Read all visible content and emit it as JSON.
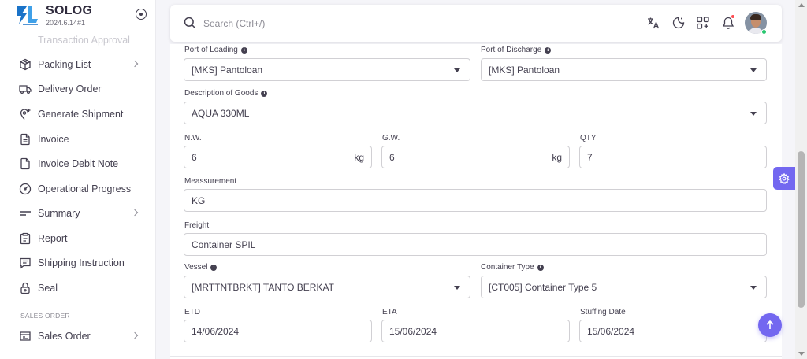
{
  "brand": {
    "name": "SOLOG",
    "version": "2024.6.14#1"
  },
  "sidebar": {
    "faded_item": "Transaction Approval",
    "items": [
      {
        "label": "Packing List",
        "icon": "package-icon",
        "has_children": true
      },
      {
        "label": "Delivery Order",
        "icon": "truck-icon",
        "has_children": false
      },
      {
        "label": "Generate Shipment",
        "icon": "map-pin-plus-icon",
        "has_children": false
      },
      {
        "label": "Invoice",
        "icon": "file-text-icon",
        "has_children": false
      },
      {
        "label": "Invoice Debit Note",
        "icon": "file-icon",
        "has_children": false
      },
      {
        "label": "Operational Progress",
        "icon": "gauge-icon",
        "has_children": false
      },
      {
        "label": "Summary",
        "icon": "menu-lines-icon",
        "has_children": true
      },
      {
        "label": "Report",
        "icon": "report-icon",
        "has_children": false
      },
      {
        "label": "Shipping Instruction",
        "icon": "message-list-icon",
        "has_children": false
      },
      {
        "label": "Seal",
        "icon": "lock-icon",
        "has_children": false
      }
    ],
    "section_header": "SALES ORDER",
    "sales_items": [
      {
        "label": "Sales Order",
        "icon": "sales-order-icon",
        "has_children": true
      }
    ]
  },
  "topbar": {
    "search_placeholder": "Search (Ctrl+/)",
    "icons": [
      "translate-icon",
      "moon-icon",
      "grid-plus-icon",
      "bell-icon"
    ],
    "notification_dot_color": "#ff4c51"
  },
  "form": {
    "port_of_loading": {
      "label": "Port of Loading",
      "value": "[MKS] Pantoloan"
    },
    "port_of_discharge": {
      "label": "Port of Discharge",
      "value": "[MKS] Pantoloan"
    },
    "description_of_goods": {
      "label": "Description of Goods",
      "value": "AQUA 330ML"
    },
    "nw": {
      "label": "N.W.",
      "value": "6",
      "unit": "kg"
    },
    "gw": {
      "label": "G.W.",
      "value": "6",
      "unit": "kg"
    },
    "qty": {
      "label": "QTY",
      "value": "7"
    },
    "measurement": {
      "label": "Meassurement",
      "value": "KG"
    },
    "freight": {
      "label": "Freight",
      "value": "Container SPIL"
    },
    "vessel": {
      "label": "Vessel",
      "value": "[MRTTNTBRKT] TANTO BERKAT"
    },
    "container_type": {
      "label": "Container Type",
      "value": "[CT005] Container Type 5"
    },
    "etd": {
      "label": "ETD",
      "value": "14/06/2024"
    },
    "eta": {
      "label": "ETA",
      "value": "15/06/2024"
    },
    "stuffing_date": {
      "label": "Stuffing Date",
      "value": "15/06/2024"
    }
  },
  "colors": {
    "accent": "#7367f0",
    "text": "#444050",
    "border": "#d1d0d4"
  }
}
